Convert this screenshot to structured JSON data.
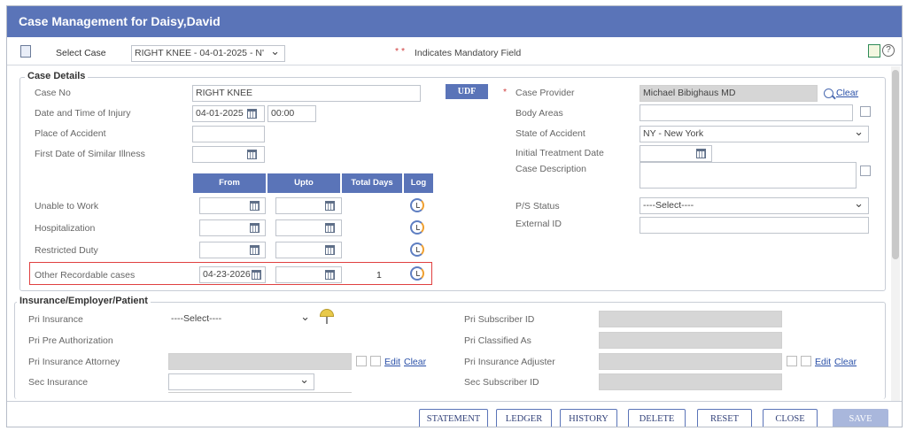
{
  "window": {
    "title": "Case Management for Daisy,David"
  },
  "topbar": {
    "select_case_label": "Select Case",
    "select_case_value": "RIGHT KNEE - 04-01-2025 - N'",
    "mandatory_marker": "* *",
    "mandatory_text": "Indicates Mandatory Field"
  },
  "case_details": {
    "title": "Case Details",
    "case_no_label": "Case No",
    "case_no_value": "RIGHT KNEE",
    "udf_label": "UDF",
    "injury_label": "Date and Time of Injury",
    "injury_date": "04-01-2025",
    "injury_time": "00:00",
    "place_label": "Place of Accident",
    "similar_label": "First Date of Similar Illness",
    "provider_marker": "*",
    "provider_label": "Case Provider",
    "provider_value": "Michael Bibighaus MD",
    "provider_clear": "Clear",
    "body_areas_label": "Body Areas",
    "state_label": "State of Accident",
    "state_value": "NY - New York",
    "treatment_label": "Initial Treatment Date",
    "description_label": "Case Description",
    "ps_label": "P/S Status",
    "ps_value": "----Select----",
    "external_label": "External ID",
    "table": {
      "from": "From",
      "upto": "Upto",
      "total": "Total Days",
      "log": "Log"
    },
    "rows": [
      {
        "label": "Unable to Work",
        "from": "",
        "total": ""
      },
      {
        "label": "Hospitalization",
        "from": "",
        "total": ""
      },
      {
        "label": "Restricted Duty",
        "from": "",
        "total": ""
      },
      {
        "label": "Other Recordable cases",
        "from": "04-23-2026",
        "total": "1"
      }
    ]
  },
  "insurance": {
    "title": "Insurance/Employer/Patient",
    "pri_insurance_label": "Pri Insurance",
    "pri_insurance_value": "----Select----",
    "pri_pre_auth_label": "Pri Pre Authorization",
    "pri_attorney_label": "Pri Insurance Attorney",
    "sec_insurance_label": "Sec Insurance",
    "pri_subscriber_label": "Pri Subscriber ID",
    "pri_classified_label": "Pri Classified As",
    "pri_adjuster_label": "Pri Insurance Adjuster",
    "sec_subscriber_label": "Sec Subscriber ID",
    "edit": "Edit",
    "clear": "Clear"
  },
  "buttons": {
    "statement": "STATEMENT",
    "ledger": "LEDGER",
    "history": "HISTORY",
    "delete": "DELETE",
    "reset": "RESET",
    "close": "CLOSE",
    "save": "SAVE"
  }
}
